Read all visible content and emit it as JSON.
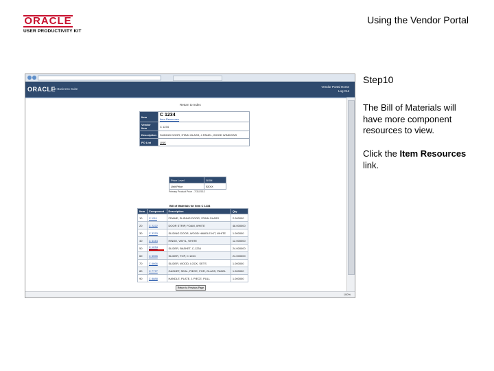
{
  "header": {
    "logo_text": "ORACLE",
    "logo_subtext": "USER PRODUCTIVITY KIT",
    "title": "Using the Vendor Portal"
  },
  "screenshot": {
    "app_brand": "ORACLE",
    "app_subtitle": "E-Business Suite",
    "top_links": [
      "Vendor Portal Home",
      "Log Out"
    ],
    "return_link": "Return to Index",
    "summary": [
      {
        "key": "Item",
        "value": "C 1234",
        "sublink": "Item Resources"
      },
      {
        "key": "Vendor Item",
        "value": "C 1234"
      },
      {
        "key": "Description",
        "value": "SLIDING DOOR, STAIN GLASS, 4 PANEL, WOOD WINDOWS"
      },
      {
        "key": "PO List",
        "value": "LINK"
      }
    ],
    "cost": {
      "headers": [
        "Price Level",
        "BOM"
      ],
      "row": [
        "Unit Price",
        "$XXX"
      ]
    },
    "price_date": "Primary Product Price - 7/31/2012",
    "bom_title": "Bill of Materials for Item C 1234",
    "bom_headers": [
      "Item",
      "Component",
      "Description",
      "Qty"
    ],
    "bom_rows": [
      [
        "10",
        "C 1111",
        "FRAME, SLIDING DOOR, STAIN GLASS",
        "2.000000"
      ],
      [
        "20",
        "C 2222",
        "DOOR STRIP, FOAM, WHITE",
        "48.000000"
      ],
      [
        "30",
        "C 3333",
        "SLIDING DOOR, WOOD HANDLE KIT, WHITE",
        "1.000000"
      ],
      [
        "40",
        "C 4444",
        "HINGE, VINYL, WHITE",
        "12.000000"
      ],
      [
        "50",
        "C 1234",
        "SLIDER, BASKET, C-1234",
        "24.000000"
      ],
      [
        "60",
        "C 5555",
        "SLIDER, TOP, C 1234",
        "24.000000"
      ],
      [
        "70",
        "C 6666",
        "SLIDER, WOOD, LOCK, SETS",
        "1.000000"
      ],
      [
        "80",
        "C 7777",
        "GASKET, SEAL, PIECE, FOR, GLASS, PANEL",
        "1.000000"
      ],
      [
        "90",
        "C 8888",
        "HANDLE, PLATE, 1 PIECE, PULL",
        "1.000000"
      ]
    ],
    "return_button": "Return to Previous Page",
    "zoom": "100%"
  },
  "instructions": {
    "step": "Step10",
    "description": "The Bill of Materials will have more component resources to view.",
    "prefix": "Click the ",
    "link": "Item Resources",
    "suffix": " link."
  }
}
